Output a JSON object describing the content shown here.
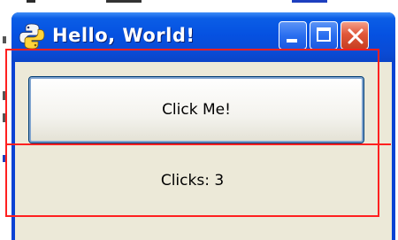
{
  "window": {
    "title": "Hello, World!",
    "title_bar_color": "#0551e1",
    "close_button_color": "#e1573a"
  },
  "titlebar_buttons": {
    "minimize_icon": "minimize-icon",
    "maximize_icon": "maximize-icon",
    "close_icon": "close-icon"
  },
  "content": {
    "button_label": "Click Me!",
    "clicks_label": "Clicks: 3",
    "background_color": "#ece9d8",
    "outline_color": "#ff2020"
  },
  "app_icon": "python-icon"
}
